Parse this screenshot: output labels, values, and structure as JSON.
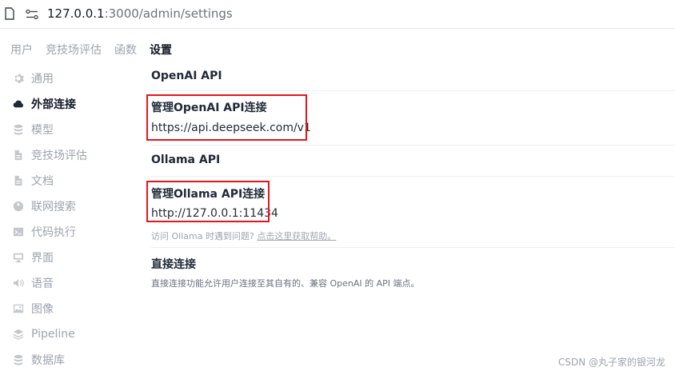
{
  "browser": {
    "url_host": "127.0.0.1",
    "url_rest": ":3000/admin/settings"
  },
  "topnav": [
    "用户",
    "竞技场评估",
    "函数",
    "设置"
  ],
  "sidebar": {
    "items": [
      {
        "label": "通用",
        "icon": "gear-icon"
      },
      {
        "label": "外部连接",
        "icon": "cloud-icon",
        "active": true
      },
      {
        "label": "模型",
        "icon": "database-icon"
      },
      {
        "label": "竞技场评估",
        "icon": "document-icon"
      },
      {
        "label": "文档",
        "icon": "document-icon"
      },
      {
        "label": "联网搜索",
        "icon": "globe-icon"
      },
      {
        "label": "代码执行",
        "icon": "terminal-icon"
      },
      {
        "label": "界面",
        "icon": "monitor-icon"
      },
      {
        "label": "语音",
        "icon": "speaker-icon"
      },
      {
        "label": "图像",
        "icon": "image-icon"
      },
      {
        "label": "Pipeline",
        "icon": "layers-icon"
      },
      {
        "label": "数据库",
        "icon": "database-icon"
      }
    ]
  },
  "main": {
    "openai_section": "OpenAI API",
    "openai_manage": "管理OpenAI API连接",
    "openai_url": "https://api.deepseek.com/v1",
    "ollama_section": "Ollama API",
    "ollama_manage": "管理Ollama API连接",
    "ollama_url": "http://127.0.0.1:11434",
    "ollama_hint": "访问 Ollama 时遇到问题?",
    "ollama_hint_link": "点击这里获取帮助。",
    "direct_title": "直接连接",
    "direct_desc": "直接连接功能允许用户连接至其自有的、兼容 OpenAI 的 API 端点。"
  },
  "watermark": "CSDN @丸子家的银河龙",
  "colors": {
    "highlight_box": "#e8151b"
  }
}
